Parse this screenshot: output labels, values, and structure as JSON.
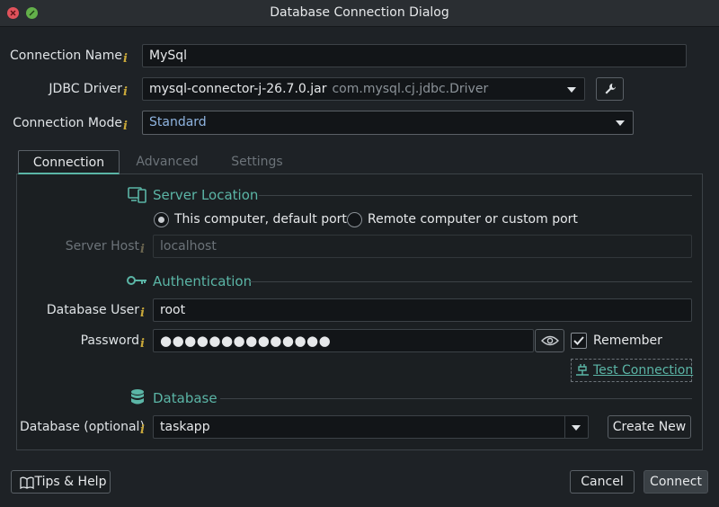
{
  "window": {
    "title": "Database Connection Dialog"
  },
  "connection_name": {
    "label": "Connection Name",
    "value": "MySql"
  },
  "jdbc_driver": {
    "label": "JDBC Driver",
    "value": "mysql-connector-j-26.7.0.jar",
    "class_name": "com.mysql.cj.jdbc.Driver"
  },
  "connection_mode": {
    "label": "Connection Mode",
    "value": "Standard"
  },
  "tabs": [
    {
      "label": "Connection",
      "active": true
    },
    {
      "label": "Advanced",
      "active": false
    },
    {
      "label": "Settings",
      "active": false
    }
  ],
  "server_location": {
    "title": "Server Location",
    "options": [
      {
        "label": "This computer, default port",
        "selected": true
      },
      {
        "label": "Remote computer or custom port",
        "selected": false
      }
    ],
    "host_label": "Server Host",
    "host_value": "localhost"
  },
  "authentication": {
    "title": "Authentication",
    "user_label": "Database User",
    "user_value": "root",
    "password_label": "Password",
    "password_mask": "●●●●●●●●●●●●●●",
    "remember_label": "Remember",
    "remember_checked": true,
    "test_label": "Test Connection"
  },
  "database": {
    "title": "Database",
    "label": "Database (optional)",
    "value": "taskapp",
    "create_label": "Create New"
  },
  "footer": {
    "help_label": "Tips & Help",
    "cancel_label": "Cancel",
    "connect_label": "Connect"
  },
  "colors": {
    "accent": "#5bb5a6",
    "info": "#c9a83a",
    "background": "#1e2226"
  },
  "icons": [
    "close-icon",
    "maximize-icon",
    "wrench-icon",
    "server-icon",
    "key-icon",
    "database-icon",
    "eye-icon",
    "plug-icon",
    "book-icon",
    "chevron-down-icon"
  ]
}
